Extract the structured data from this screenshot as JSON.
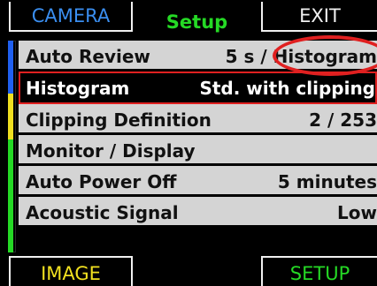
{
  "tabs": {
    "camera": "CAMERA",
    "setup": "Setup",
    "exit": "EXIT",
    "image": "IMAGE",
    "setup_bottom": "SETUP"
  },
  "menu": [
    {
      "label": "Auto Review",
      "value": "5 s / Histogram"
    },
    {
      "label": "Histogram",
      "value": "Std. with clipping",
      "selected": true
    },
    {
      "label": "Clipping Definition",
      "value": "2 / 253"
    },
    {
      "label": "Monitor / Display",
      "value": ""
    },
    {
      "label": "Auto Power Off",
      "value": "5 minutes"
    },
    {
      "label": "Acoustic Signal",
      "value": "Low"
    }
  ],
  "colors": {
    "accent_blue": "#3a8ef0",
    "accent_green": "#25d925",
    "accent_yellow": "#f0e020",
    "highlight_red": "#e02020"
  }
}
